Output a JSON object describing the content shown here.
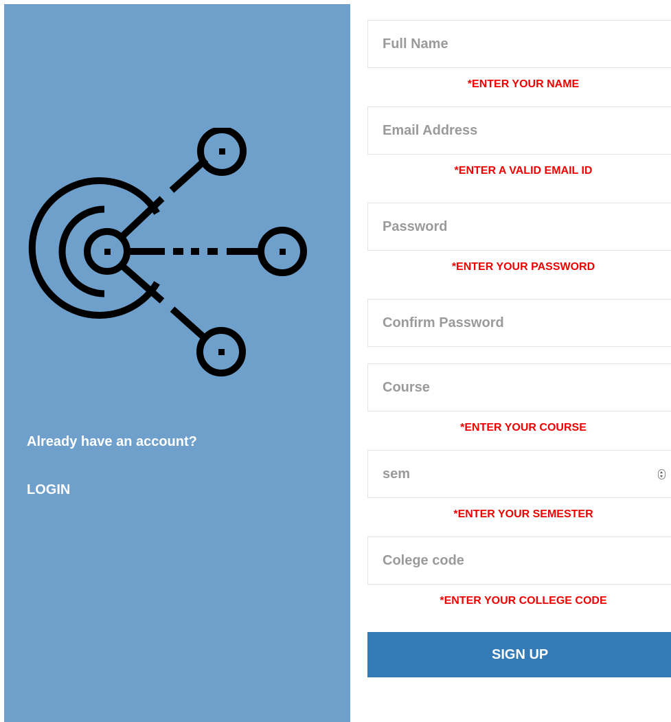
{
  "sidebar": {
    "already_text": "Already have an account?",
    "login_label": "LOGIN",
    "panel_color": "#6fa0cc",
    "logo_icon": "network-radar-icon"
  },
  "form": {
    "full_name": {
      "placeholder": "Full Name",
      "value": "",
      "error": "*ENTER YOUR NAME"
    },
    "email": {
      "placeholder": "Email Address",
      "value": "",
      "error": "*ENTER A VALID EMAIL ID"
    },
    "password": {
      "placeholder": "Password",
      "value": "",
      "error": "*ENTER YOUR PASSWORD"
    },
    "confirm_password": {
      "placeholder": "Confirm Password",
      "value": ""
    },
    "course": {
      "placeholder": "Course",
      "value": "",
      "error": "*ENTER YOUR COURSE"
    },
    "sem": {
      "placeholder": "sem",
      "value": "",
      "error": "*ENTER YOUR SEMESTER"
    },
    "college_code": {
      "placeholder": "Colege code",
      "value": "",
      "error": "*ENTER YOUR COLLEGE CODE"
    },
    "signup_label": "SIGN UP",
    "error_color": "#ee0000",
    "button_color": "#337ab7"
  }
}
